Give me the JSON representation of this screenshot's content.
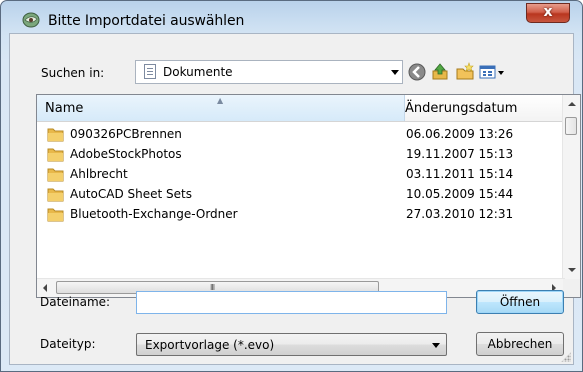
{
  "window": {
    "title": "Bitte Importdatei auswählen",
    "close_label": "x"
  },
  "lookin": {
    "label": "Suchen in:",
    "value": "Dokumente"
  },
  "toolbar": {
    "icons": [
      "back-icon",
      "up-folder-icon",
      "new-folder-icon",
      "view-menu-icon"
    ]
  },
  "file_list": {
    "columns": [
      "Name",
      "Änderungsdatum"
    ],
    "rows": [
      {
        "name": "090326PCBrennen",
        "date": "06.06.2009 13:26"
      },
      {
        "name": "AdobeStockPhotos",
        "date": "19.11.2007 15:13"
      },
      {
        "name": "Ahlbrecht",
        "date": "03.11.2011 15:14"
      },
      {
        "name": "AutoCAD Sheet Sets",
        "date": "10.05.2009 15:44"
      },
      {
        "name": "Bluetooth-Exchange-Ordner",
        "date": "27.03.2010 12:31"
      }
    ]
  },
  "filename": {
    "label": "Dateiname:",
    "value": ""
  },
  "filetype": {
    "label": "Dateityp:",
    "value": "Exportvorlage (*.evo)"
  },
  "buttons": {
    "open": "Öffnen",
    "cancel": "Abbrechen"
  },
  "colors": {
    "title_gradient": "#c7dcf0",
    "close_button": "#c7563f",
    "folder": "#e8b84a",
    "header_highlight": "#d6eaf9"
  }
}
